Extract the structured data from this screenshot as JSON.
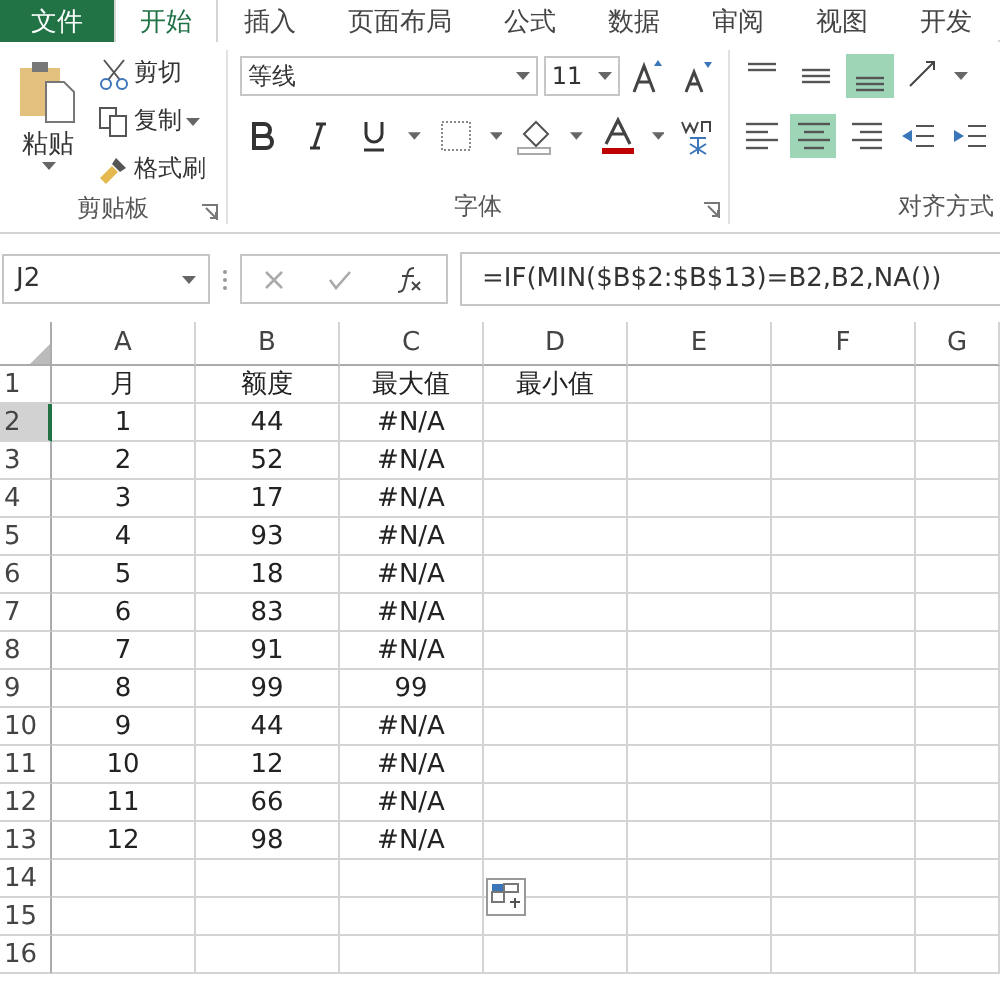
{
  "tabs": [
    {
      "label": "文件",
      "kind": "file",
      "selected": false
    },
    {
      "label": "开始",
      "kind": "tab",
      "selected": true
    },
    {
      "label": "插入",
      "kind": "tab",
      "selected": false
    },
    {
      "label": "页面布局",
      "kind": "tab",
      "selected": false
    },
    {
      "label": "公式",
      "kind": "tab",
      "selected": false
    },
    {
      "label": "数据",
      "kind": "tab",
      "selected": false
    },
    {
      "label": "审阅",
      "kind": "tab",
      "selected": false
    },
    {
      "label": "视图",
      "kind": "tab",
      "selected": false
    },
    {
      "label": "开发",
      "kind": "tab",
      "selected": false
    }
  ],
  "clipboard": {
    "paste": "粘贴",
    "cut": "剪切",
    "copy": "复制",
    "format_painter": "格式刷",
    "label": "剪贴板"
  },
  "font": {
    "name": "等线",
    "size": "11",
    "label": "字体",
    "bold": false,
    "italic": false,
    "underline": false
  },
  "alignment": {
    "label": "对齐方式",
    "vertical": [
      {
        "kind": "top",
        "selected": false
      },
      {
        "kind": "middle",
        "selected": false
      },
      {
        "kind": "bottom",
        "selected": true
      }
    ],
    "horizontal": [
      {
        "kind": "left",
        "selected": false
      },
      {
        "kind": "center",
        "selected": true
      },
      {
        "kind": "right",
        "selected": false
      }
    ]
  },
  "formula_bar": {
    "name_box": "J2",
    "formula": "=IF(MIN($B$2:$B$13)=B2,B2,NA())"
  },
  "sheet": {
    "columns": [
      "A",
      "B",
      "C",
      "D",
      "E",
      "F",
      "G"
    ],
    "rows": [
      {
        "header": "1",
        "selected": false,
        "cells": [
          "月",
          "额度",
          "最大值",
          "最小值"
        ]
      },
      {
        "header": "2",
        "selected": true,
        "cells": [
          "1",
          "44",
          "#N/A"
        ]
      },
      {
        "header": "3",
        "selected": false,
        "cells": [
          "2",
          "52",
          "#N/A"
        ]
      },
      {
        "header": "4",
        "selected": false,
        "cells": [
          "3",
          "17",
          "#N/A"
        ]
      },
      {
        "header": "5",
        "selected": false,
        "cells": [
          "4",
          "93",
          "#N/A"
        ]
      },
      {
        "header": "6",
        "selected": false,
        "cells": [
          "5",
          "18",
          "#N/A"
        ]
      },
      {
        "header": "7",
        "selected": false,
        "cells": [
          "6",
          "83",
          "#N/A"
        ]
      },
      {
        "header": "8",
        "selected": false,
        "cells": [
          "7",
          "91",
          "#N/A"
        ]
      },
      {
        "header": "9",
        "selected": false,
        "cells": [
          "8",
          "99",
          "99"
        ]
      },
      {
        "header": "10",
        "selected": false,
        "cells": [
          "9",
          "44",
          "#N/A"
        ]
      },
      {
        "header": "11",
        "selected": false,
        "cells": [
          "10",
          "12",
          "#N/A"
        ]
      },
      {
        "header": "12",
        "selected": false,
        "cells": [
          "11",
          "66",
          "#N/A"
        ]
      },
      {
        "header": "13",
        "selected": false,
        "cells": [
          "12",
          "98",
          "#N/A"
        ]
      },
      {
        "header": "14",
        "selected": false,
        "cells": []
      },
      {
        "header": "15",
        "selected": false,
        "cells": []
      },
      {
        "header": "16",
        "selected": false,
        "cells": []
      }
    ]
  }
}
